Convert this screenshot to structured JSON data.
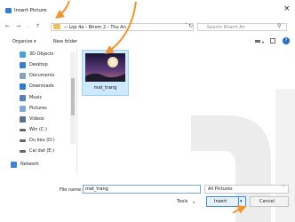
{
  "window": {
    "title": "Insert Picture",
    "close_glyph": "×"
  },
  "address": {
    "breadcrumb": "‹‹  Lop 4a  ›  Nhom 2  ›  Thu An",
    "refresh_glyph": "↻"
  },
  "search": {
    "placeholder": "Search Khanh An"
  },
  "toolbar": {
    "organize_label": "Organize ▾",
    "new_folder_label": "New folder",
    "help_glyph": "?"
  },
  "sidebar": {
    "items": [
      {
        "label": "3D Objects",
        "icon": "3d-objects-icon",
        "color": "#4aa3df"
      },
      {
        "label": "Desktop",
        "icon": "desktop-icon",
        "color": "#3b7ed1"
      },
      {
        "label": "Documents",
        "icon": "documents-icon",
        "color": "#8aa0b8"
      },
      {
        "label": "Downloads",
        "icon": "downloads-icon",
        "color": "#2e7bd1"
      },
      {
        "label": "Music",
        "icon": "music-icon",
        "color": "#5a7fb5"
      },
      {
        "label": "Pictures",
        "icon": "pictures-icon",
        "color": "#7fa8d6"
      },
      {
        "label": "Videos",
        "icon": "videos-icon",
        "color": "#5d6f8b"
      },
      {
        "label": "Win (C:)",
        "icon": "drive-icon",
        "color": "#666666"
      },
      {
        "label": "Du lieu (D:)",
        "icon": "drive-icon",
        "color": "#666666"
      },
      {
        "label": "Cai dat (E:)",
        "icon": "drive-icon",
        "color": "#666666"
      },
      {
        "label": "Network",
        "icon": "network-icon",
        "color": "#3a86d6"
      }
    ]
  },
  "files": [
    {
      "name": "mat_trang",
      "icon": "image-thumbnail-icon"
    }
  ],
  "footer": {
    "filename_label": "File name:",
    "filename_value": "mat_trang",
    "filetype_value": "All Pictures",
    "tools_label": "Tools",
    "insert_label": "Insert",
    "cancel_label": "Cancel"
  },
  "colors": {
    "accent": "#f4922b",
    "selection": "#cde8ff",
    "button_border": "#3c8ee0"
  }
}
